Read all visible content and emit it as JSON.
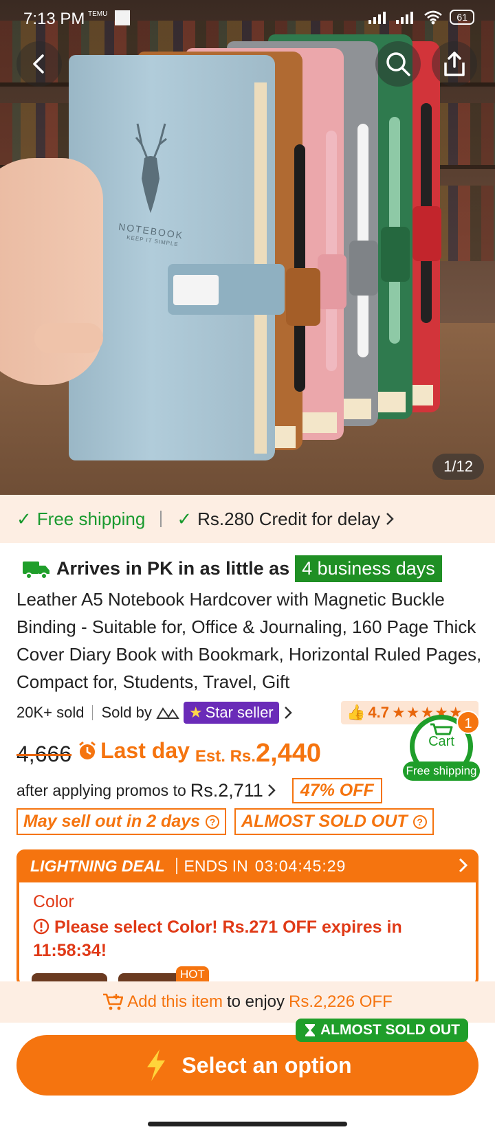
{
  "status_bar": {
    "time": "7:13 PM",
    "app_tag": "TEMU",
    "battery": "61"
  },
  "hero": {
    "counter": "1/12",
    "notebook_text": "NOTEBOOK",
    "notebook_sub": "KEEP IT SIMPLE"
  },
  "shipping": {
    "free": "Free shipping",
    "credit": "Rs.280 Credit for delay"
  },
  "arrival": {
    "text": "Arrives in PK in as little as",
    "days": "4 business days"
  },
  "product": {
    "title": "Leather A5 Notebook Hardcover with Magnetic Buckle Binding - Suitable for, Office & Journaling, 160 Page Thick Cover Diary Book with Bookmark, Horizontal Ruled Pages, Compact for, Students, Travel, Gift",
    "sold": "20K+ sold",
    "sold_by": "Sold by",
    "star_seller": "Star seller",
    "rating": "4.7"
  },
  "cart": {
    "label": "Cart",
    "count": "1",
    "free_shipping": "Free shipping"
  },
  "price": {
    "old": "4,666",
    "last_day": "Last day",
    "est": "Est. Rs.",
    "current": "2,440",
    "after_promo_text": "after applying promos to",
    "after_promo_price": "Rs.2,711",
    "off": "47% OFF"
  },
  "urgency": {
    "sell_out": "May sell out in 2 days",
    "almost_sold": "ALMOST SOLD OUT"
  },
  "deal": {
    "title": "LIGHTNING DEAL",
    "ends_in": "ENDS IN",
    "timer": "03:04:45:29",
    "color_label": "Color",
    "warning": "Please select Color! Rs.271 OFF expires in 11:58:34!",
    "hot": "HOT"
  },
  "bottom": {
    "add_item": "Add this item",
    "to_enjoy": "to enjoy",
    "discount": "Rs.2,226 OFF",
    "almost_sold": "ALMOST SOLD OUT",
    "cta": "Select an option"
  },
  "colors": {
    "accent": "#f5740f",
    "green": "#1f9e2a",
    "star_purple": "#6a2bb8",
    "warn_red": "#e03a17"
  }
}
